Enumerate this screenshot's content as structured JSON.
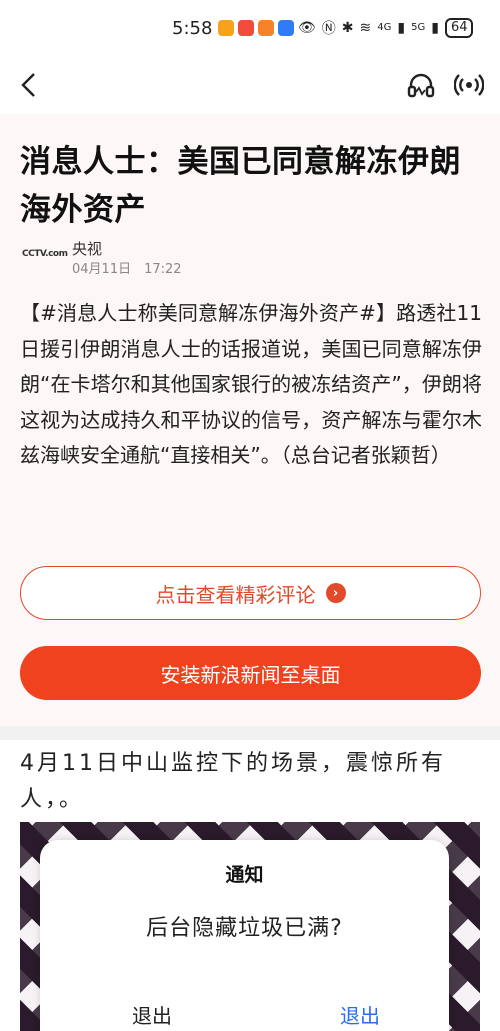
{
  "status_bar": {
    "time": "5:58",
    "network_1": "4G",
    "network_2": "5G",
    "battery": "64"
  },
  "article": {
    "title": "消息人士：美国已同意解冻伊朗海外资产",
    "source_logo": "CCTV.com",
    "source_name": "央视",
    "publish_time": "04月11日　17:22",
    "body": "【#消息人士称美同意解冻伊海外资产#】路透社11日援引伊朗消息人士的话报道说，美国已同意解冻伊朗“在卡塔尔和其他国家银行的被冻结资产”，伊朗将这视为达成持久和平协议的信号，资产解冻与霍尔木兹海峡安全通航“直接相关”。（总台记者张颖哲）"
  },
  "actions": {
    "view_comments": "点击查看精彩评论",
    "install_app": "安装新浪新闻至桌面"
  },
  "next_item": {
    "title": "4月11日中山监控下的场景，震惊所有人，。"
  },
  "dialog": {
    "title": "通知",
    "message": "后台隐藏垃圾已满?",
    "button_left": "退出",
    "button_right": "退出"
  },
  "colors": {
    "accent": "#f0421e",
    "dialog_link": "#2a6cf0"
  }
}
